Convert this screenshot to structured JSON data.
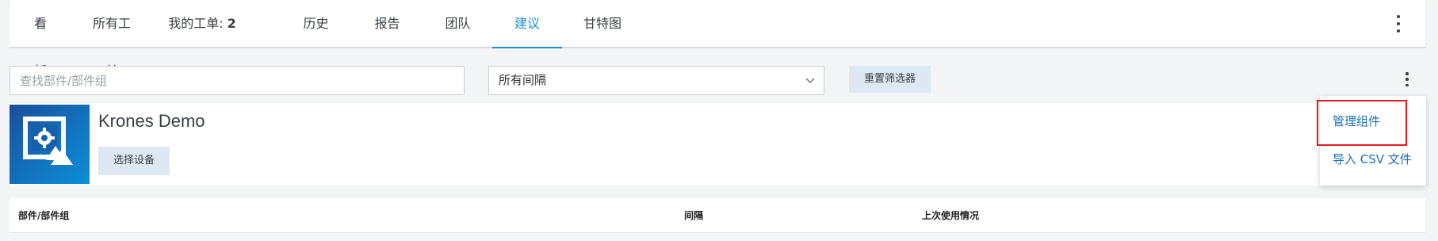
{
  "tabs": [
    {
      "label": "看板"
    },
    {
      "label": "所有工单"
    },
    {
      "label": "我的工单: ",
      "count": "2"
    },
    {
      "label": "历史"
    },
    {
      "label": "报告"
    },
    {
      "label": "团队"
    },
    {
      "label": "建议",
      "active": true
    },
    {
      "label": "甘特图"
    }
  ],
  "filters": {
    "search_placeholder": "查找部件/部件组",
    "interval_selected": "所有间隔",
    "reset_label": "重置筛选器"
  },
  "device": {
    "name": "Krones Demo",
    "select_label": "选择设备"
  },
  "table": {
    "columns": [
      "部件/部件组",
      "间隔",
      "上次使用情况"
    ]
  },
  "menu": {
    "items": [
      "管理组件",
      "导入 CSV 文件"
    ]
  },
  "colors": {
    "accent": "#1f8fd6",
    "link": "#1a6fb8",
    "highlight": "#e21c22",
    "button_bg": "#dde8f2"
  },
  "icons": {
    "top_menu": "more-vertical-icon",
    "filter_menu": "more-vertical-icon",
    "select_chevron": "chevron-down-icon",
    "device_image": "image-settings-icon"
  }
}
